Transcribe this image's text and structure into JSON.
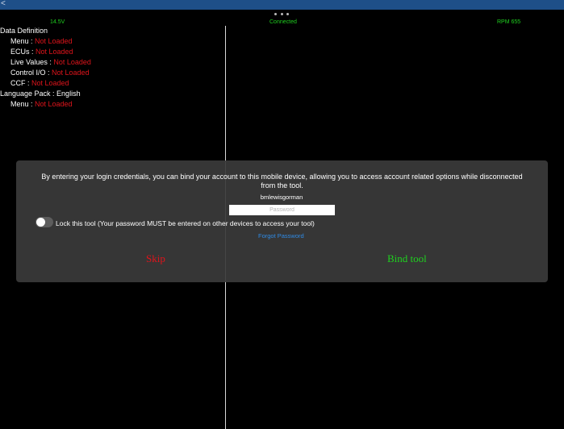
{
  "topbar": {
    "back_glyph": "<",
    "icon": "chevron-left-icon"
  },
  "header": {
    "menu_icon": "more-dots-icon",
    "voltage": "14.5V",
    "connection": "Connected",
    "rpm": "RPM 655"
  },
  "info": {
    "data_definition": "Data Definition",
    "items": [
      {
        "label": "Menu : ",
        "value": "Not Loaded"
      },
      {
        "label": "ECUs : ",
        "value": "Not Loaded"
      },
      {
        "label": "Live Values : ",
        "value": "Not Loaded"
      },
      {
        "label": "Control I/O : ",
        "value": "Not Loaded"
      },
      {
        "label": "CCF : ",
        "value": "Not Loaded"
      }
    ],
    "language_pack": "Language Pack : English",
    "language_items": [
      {
        "label": "Menu : ",
        "value": "Not Loaded"
      }
    ]
  },
  "dialog": {
    "message": "By entering your login credentials, you can bind your account to this mobile device, allowing you to access account related options while disconnected from the tool.",
    "username": "bmlewisgorman",
    "password_placeholder": "Password",
    "password_value": "",
    "lock_label": "Lock this tool (Your password MUST be entered on other devices to access your tool)",
    "lock_enabled": false,
    "forgot_password": "Forgot Password",
    "skip": "Skip",
    "bind": "Bind tool"
  },
  "colors": {
    "background": "#000000",
    "topbar": "#1e4f88",
    "status_green": "#1fd01f",
    "error_red": "#e0141b",
    "link_blue": "#2f8be6",
    "dialog_bg": "#3a3a3a"
  }
}
